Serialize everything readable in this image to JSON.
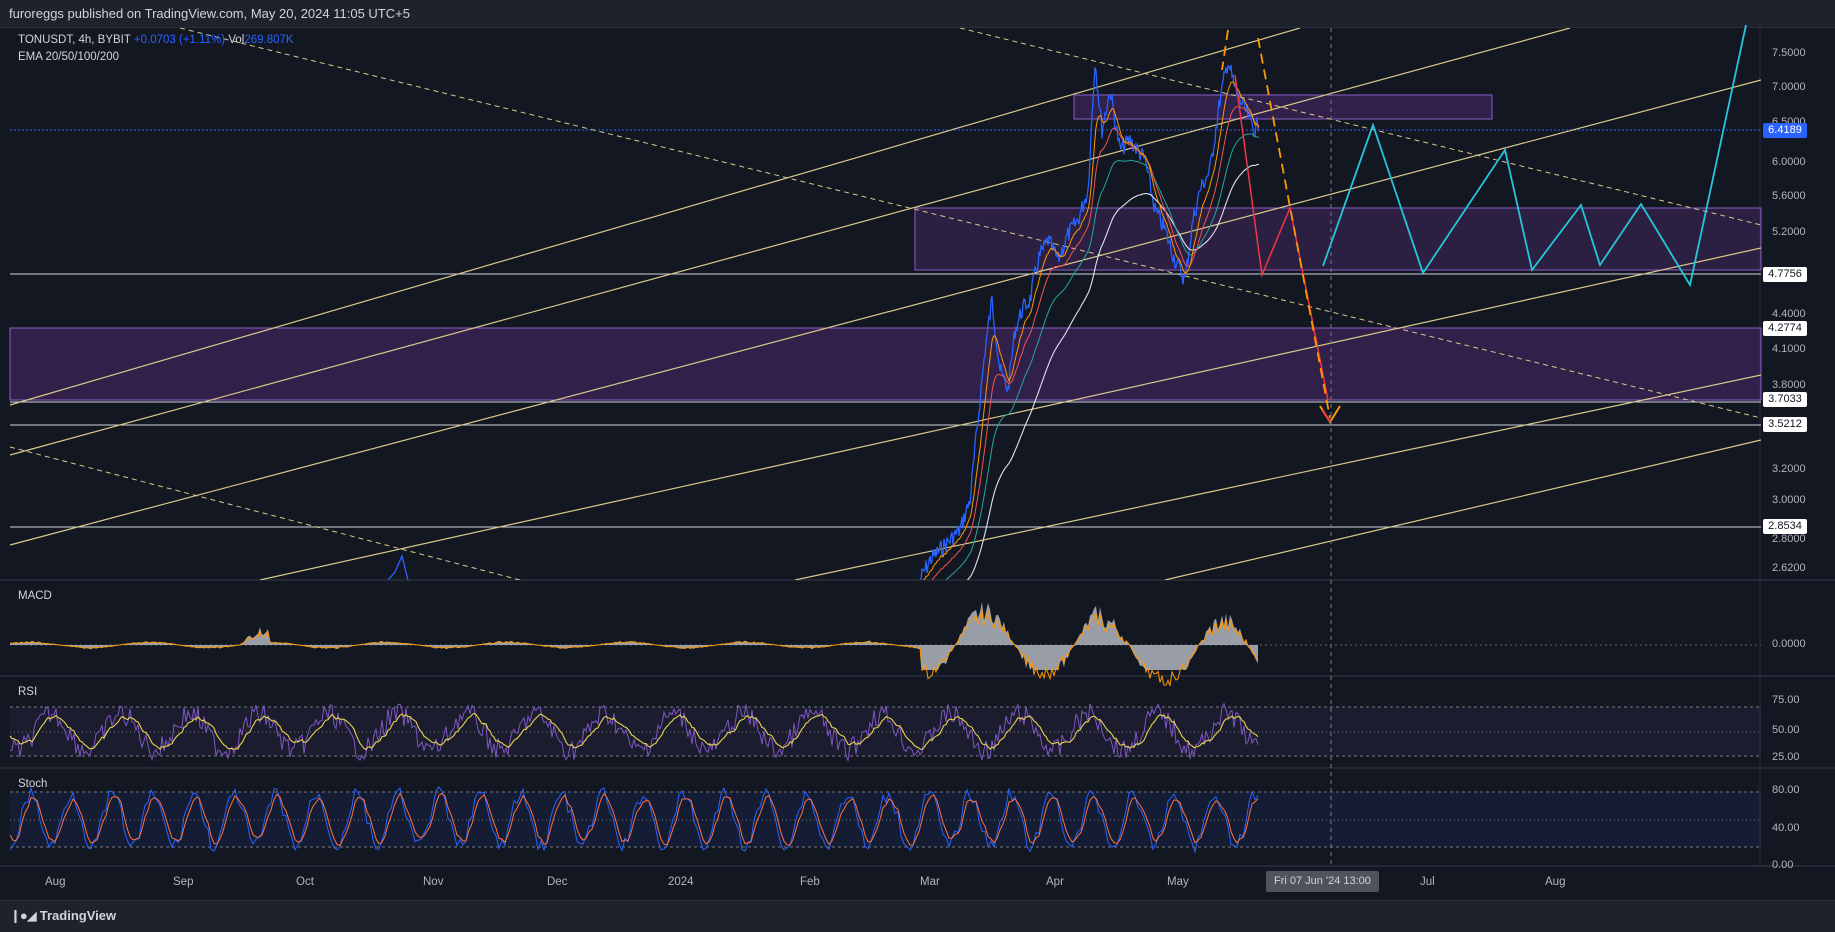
{
  "header": {
    "publisher_line": "furoreggs published on TradingView.com, May 20, 2024 11:05 UTC+5"
  },
  "legend": {
    "symbol_line": "TONUSDT, 4h, BYBIT",
    "change": "+0.0703 (+1.11%)",
    "vol_label": "Vol",
    "vol_value": "269.807K",
    "ema_line": "EMA 20/50/100/200"
  },
  "panes": {
    "macd_label": "MACD",
    "rsi_label": "RSI",
    "stoch_label": "Stoch"
  },
  "price_axis": {
    "ticks": [
      "7.5000",
      "7.0000",
      "6.5000",
      "6.0000",
      "5.6000",
      "5.2000",
      "4.4000",
      "4.1000",
      "3.8000",
      "3.2000",
      "3.0000",
      "2.8000",
      "2.6200"
    ],
    "tags": {
      "current": "6.4189",
      "level_1": "4.7756",
      "level_2": "4.2774",
      "level_3": "3.7033",
      "level_4": "3.5212",
      "level_5": "2.8534"
    }
  },
  "macd_axis": {
    "zero": "0.0000"
  },
  "rsi_axis": {
    "ticks": [
      "75.00",
      "50.00",
      "25.00"
    ]
  },
  "stoch_axis": {
    "ticks": [
      "80.00",
      "40.00",
      "0.00"
    ]
  },
  "time_axis": {
    "ticks": [
      "Aug",
      "Sep",
      "Oct",
      "Nov",
      "Dec",
      "2024",
      "Feb",
      "Mar",
      "Apr",
      "May",
      "Jul",
      "Aug"
    ],
    "crosshair_label": "Fri 07 Jun '24   13:00"
  },
  "footer": {
    "brand": "TradingView"
  },
  "colors": {
    "background": "#131722",
    "price_line": "#2962ff",
    "zone_fill": "#4a2a6b",
    "channel_line": "#d8c98a",
    "projection_cyan": "#26c6da",
    "projection_red": "#f23645",
    "projection_orange": "#ff9800"
  }
}
